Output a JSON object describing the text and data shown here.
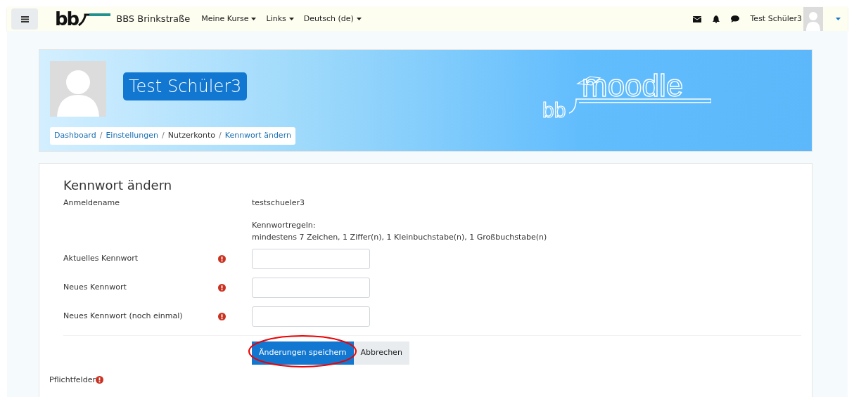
{
  "navbar": {
    "logo_text": "bb",
    "site_name": "BBS Brinkstraße",
    "menus": [
      {
        "label": "Meine Kurse"
      },
      {
        "label": "Links"
      },
      {
        "label": "Deutsch (de)"
      }
    ],
    "user_name": "Test Schüler3"
  },
  "header": {
    "name": "Test Schüler3",
    "logo_prefix": "bb",
    "logo_word": "moodle",
    "breadcrumb": [
      {
        "label": "Dashboard",
        "link": true
      },
      {
        "separator": "/",
        "label": "Einstellungen",
        "link": true
      },
      {
        "separator": "/",
        "label": "Nutzerkonto",
        "link": false
      },
      {
        "separator": "/",
        "label": "Kennwort ändern",
        "link": true
      }
    ]
  },
  "form": {
    "title": "Kennwort ändern",
    "username_label": "Anmeldename",
    "username": "testschueler3",
    "rules_title": "Kennwortregeln:",
    "rules": "mindestens 7 Zeichen, 1 Ziffer(n), 1 Kleinbuchstabe(n), 1 Großbuchstabe(n)",
    "fields": [
      {
        "label": "Aktuelles Kennwort",
        "required": true
      },
      {
        "label": "Neues Kennwort",
        "required": true
      },
      {
        "label": "Neues Kennwort (noch einmal)",
        "required": true
      }
    ],
    "save_button": {
      "label": "Änderungen speichern",
      "highlighted": true
    },
    "cancel_button": {
      "label": "Abbrechen"
    },
    "required_note": "Pflichtfelder"
  }
}
